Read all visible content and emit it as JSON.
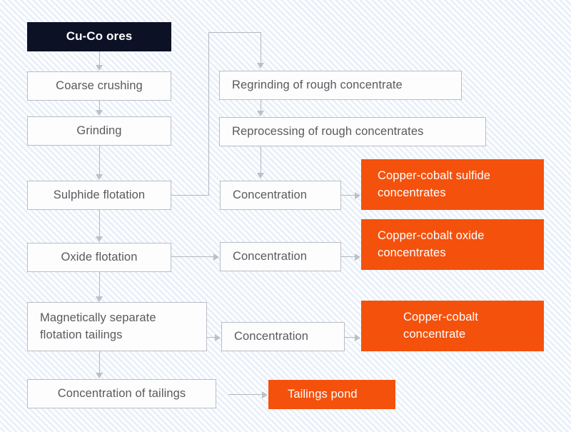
{
  "diagram": {
    "title": "Cu-Co ore beneficiation process flowsheet",
    "colors": {
      "accent_orange": "#f4510d",
      "header_navy": "#0c1126",
      "box_border": "#b9bdc5",
      "box_fill": "#fdfdfe",
      "text_grey": "#5a5a5e",
      "connector_grey": "#b4b8c0",
      "background": "#fdfeff"
    },
    "nodes": [
      {
        "id": "cu-co-ores",
        "label": "Cu-Co ores",
        "style": "dark"
      },
      {
        "id": "coarse-crushing",
        "label": "Coarse crushing",
        "style": "plain"
      },
      {
        "id": "grinding",
        "label": "Grinding",
        "style": "plain"
      },
      {
        "id": "sulphide-flotation",
        "label": "Sulphide flotation",
        "style": "plain"
      },
      {
        "id": "oxide-flotation",
        "label": "Oxide flotation",
        "style": "plain"
      },
      {
        "id": "magnetically-separate-flotation-tailings",
        "label": "Magnetically separate flotation tailings",
        "style": "plain"
      },
      {
        "id": "concentration-of-tailings",
        "label": "Concentration of tailings",
        "style": "plain"
      },
      {
        "id": "regrinding-of-rough-concentrate",
        "label": "Regrinding of rough concentrate",
        "style": "plain"
      },
      {
        "id": "reprocessing-of-rough-concentrates",
        "label": "Reprocessing of rough concentrates",
        "style": "plain"
      },
      {
        "id": "concentration-sulphide",
        "label": "Concentration",
        "style": "plain"
      },
      {
        "id": "concentration-oxide",
        "label": "Concentration",
        "style": "plain"
      },
      {
        "id": "concentration-magnetic",
        "label": "Concentration",
        "style": "plain"
      },
      {
        "id": "copper-cobalt-sulfide-concentrates",
        "label": "Copper-cobalt sulfide concentrates",
        "style": "accent"
      },
      {
        "id": "copper-cobalt-oxide-concentrates",
        "label": "Copper-cobalt oxide concentrates",
        "style": "accent"
      },
      {
        "id": "copper-cobalt-concentrate",
        "label": "Copper-cobalt concentrate",
        "style": "accent"
      },
      {
        "id": "tailings-pond",
        "label": "Tailings pond",
        "style": "accent"
      }
    ],
    "labels": {
      "cu_co_ores": "Cu-Co ores",
      "coarse_crushing": "Coarse crushing",
      "grinding": "Grinding",
      "sulphide_flotation": "Sulphide flotation",
      "oxide_flotation": "Oxide flotation",
      "magnetically_separate_line1": "Magnetically separate",
      "magnetically_separate_line2": "flotation tailings",
      "concentration_of_tailings": "Concentration of tailings",
      "regrinding_of_rough_concentrate": "Regrinding of rough concentrate",
      "reprocessing_of_rough_concentrates": "Reprocessing of rough concentrates",
      "concentration_sulphide": "Concentration",
      "concentration_oxide": "Concentration",
      "concentration_magnetic": "Concentration",
      "cu_co_sulfide_line1": "Copper-cobalt sulfide",
      "cu_co_sulfide_line2": "concentrates",
      "cu_co_oxide_line1": "Copper-cobalt oxide",
      "cu_co_oxide_line2": "concentrates",
      "cu_co_conc_line1": "Copper-cobalt",
      "cu_co_conc_line2": "concentrate",
      "tailings_pond": "Tailings pond"
    },
    "edges": [
      {
        "from": "cu-co-ores",
        "to": "coarse-crushing",
        "kind": "vertical"
      },
      {
        "from": "coarse-crushing",
        "to": "grinding",
        "kind": "vertical"
      },
      {
        "from": "grinding",
        "to": "sulphide-flotation",
        "kind": "vertical"
      },
      {
        "from": "sulphide-flotation",
        "to": "oxide-flotation",
        "kind": "vertical"
      },
      {
        "from": "oxide-flotation",
        "to": "magnetically-separate-flotation-tailings",
        "kind": "vertical"
      },
      {
        "from": "magnetically-separate-flotation-tailings",
        "to": "concentration-of-tailings",
        "kind": "vertical"
      },
      {
        "from": "sulphide-flotation",
        "to": "regrinding-of-rough-concentrate",
        "kind": "elbow-up-right"
      },
      {
        "from": "regrinding-of-rough-concentrate",
        "to": "reprocessing-of-rough-concentrates",
        "kind": "vertical"
      },
      {
        "from": "reprocessing-of-rough-concentrates",
        "to": "concentration-sulphide",
        "kind": "vertical"
      },
      {
        "from": "concentration-sulphide",
        "to": "copper-cobalt-sulfide-concentrates",
        "kind": "horizontal"
      },
      {
        "from": "oxide-flotation",
        "to": "concentration-oxide",
        "kind": "horizontal"
      },
      {
        "from": "concentration-oxide",
        "to": "copper-cobalt-oxide-concentrates",
        "kind": "horizontal"
      },
      {
        "from": "magnetically-separate-flotation-tailings",
        "to": "concentration-magnetic",
        "kind": "horizontal"
      },
      {
        "from": "concentration-magnetic",
        "to": "copper-cobalt-concentrate",
        "kind": "horizontal"
      },
      {
        "from": "concentration-of-tailings",
        "to": "tailings-pond",
        "kind": "horizontal"
      }
    ]
  }
}
